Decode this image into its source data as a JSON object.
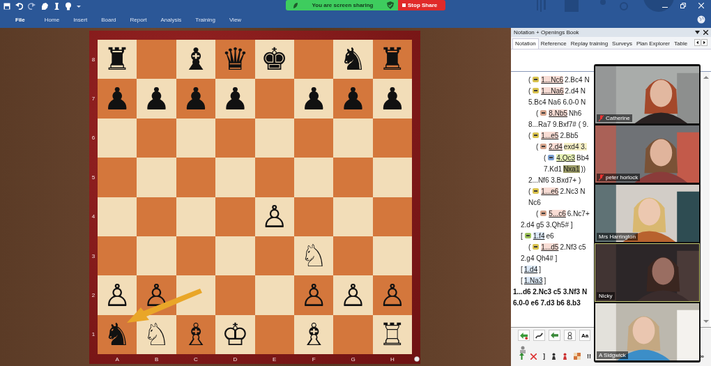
{
  "screen_share": {
    "status": "You are screen sharing",
    "stop_button": "Stop Share"
  },
  "ribbon_tabs": [
    {
      "label": "File",
      "selected": true
    },
    {
      "label": "Home",
      "selected": false
    },
    {
      "label": "Insert",
      "selected": false
    },
    {
      "label": "Board",
      "selected": false
    },
    {
      "label": "Report",
      "selected": false
    },
    {
      "label": "Analysis",
      "selected": false
    },
    {
      "label": "Training",
      "selected": false
    },
    {
      "label": "View",
      "selected": false
    }
  ],
  "board": {
    "ranks": [
      {
        "label": "8",
        "squares": [
          {
            "dark": false,
            "piece": "♜"
          },
          {
            "dark": true
          },
          {
            "dark": false,
            "piece": "♝"
          },
          {
            "dark": true,
            "piece": "♛"
          },
          {
            "dark": false,
            "piece": "♚"
          },
          {
            "dark": true
          },
          {
            "dark": false,
            "piece": "♞"
          },
          {
            "dark": true,
            "piece": "♜"
          }
        ]
      },
      {
        "label": "7",
        "squares": [
          {
            "dark": true,
            "piece": "♟"
          },
          {
            "dark": false,
            "piece": "♟"
          },
          {
            "dark": true,
            "piece": "♟"
          },
          {
            "dark": false,
            "piece": "♟"
          },
          {
            "dark": true
          },
          {
            "dark": false,
            "piece": "♟"
          },
          {
            "dark": true,
            "piece": "♟"
          },
          {
            "dark": false,
            "piece": "♟"
          }
        ]
      },
      {
        "label": "6",
        "squares": [
          {
            "dark": false
          },
          {
            "dark": true
          },
          {
            "dark": false
          },
          {
            "dark": true
          },
          {
            "dark": false
          },
          {
            "dark": true
          },
          {
            "dark": false
          },
          {
            "dark": true
          }
        ]
      },
      {
        "label": "5",
        "squares": [
          {
            "dark": true
          },
          {
            "dark": false
          },
          {
            "dark": true
          },
          {
            "dark": false
          },
          {
            "dark": true
          },
          {
            "dark": false
          },
          {
            "dark": true
          },
          {
            "dark": false
          }
        ]
      },
      {
        "label": "4",
        "squares": [
          {
            "dark": false
          },
          {
            "dark": true
          },
          {
            "dark": false
          },
          {
            "dark": true
          },
          {
            "dark": false,
            "piece": "♙"
          },
          {
            "dark": true
          },
          {
            "dark": false
          },
          {
            "dark": true
          }
        ]
      },
      {
        "label": "3",
        "squares": [
          {
            "dark": true
          },
          {
            "dark": false
          },
          {
            "dark": true
          },
          {
            "dark": false
          },
          {
            "dark": true
          },
          {
            "dark": false,
            "piece": "♘"
          },
          {
            "dark": true
          },
          {
            "dark": false
          }
        ]
      },
      {
        "label": "2",
        "squares": [
          {
            "dark": false,
            "piece": "♙"
          },
          {
            "dark": true,
            "piece": "♙"
          },
          {
            "dark": false
          },
          {
            "dark": true
          },
          {
            "dark": false
          },
          {
            "dark": true,
            "piece": "♙"
          },
          {
            "dark": false,
            "piece": "♙"
          },
          {
            "dark": true,
            "piece": "♙"
          }
        ]
      },
      {
        "label": "1",
        "squares": [
          {
            "dark": true,
            "piece": "♞"
          },
          {
            "dark": false,
            "piece": "♘"
          },
          {
            "dark": true,
            "piece": "♗"
          },
          {
            "dark": false,
            "piece": "♔"
          },
          {
            "dark": true
          },
          {
            "dark": false,
            "piece": "♗"
          },
          {
            "dark": true
          },
          {
            "dark": false,
            "piece": "♖"
          }
        ]
      }
    ],
    "files": [
      "A",
      "B",
      "C",
      "D",
      "E",
      "F",
      "G",
      "H"
    ]
  },
  "panel": {
    "title": "Notation + Openings Book",
    "tabs": [
      {
        "label": "Notation",
        "selected": true
      },
      {
        "label": "Reference",
        "selected": false
      },
      {
        "label": "Replay training",
        "selected": false
      },
      {
        "label": "Surveys",
        "selected": false
      },
      {
        "label": "Plan Explorer",
        "selected": false
      },
      {
        "label": "Table",
        "selected": false
      }
    ],
    "notation": [
      {
        "children": [
          {
            "children": [
              {
                "tokens": [
                  {
                    "kind": "text",
                    "text": "("
                  },
                  {
                    "kind": "badge",
                    "color": "#d9c24e"
                  },
                  {
                    "kind": "move",
                    "text": "1...Nc6",
                    "color": "#f8dcd4"
                  },
                  {
                    "kind": "text",
                    "text": "2.Bc4 N"
                  }
                ]
              },
              {
                "tokens": [
                  {
                    "kind": "text",
                    "text": "("
                  },
                  {
                    "kind": "badge",
                    "color": "#d9c24e"
                  },
                  {
                    "kind": "move",
                    "text": "1...Na6",
                    "color": "#f8dcd4"
                  },
                  {
                    "kind": "text",
                    "text": "2.d4 N"
                  }
                ]
              },
              {
                "tokens": [
                  {
                    "kind": "text",
                    "text": "5.Bc4 Na6 6.0-0 N"
                  }
                ]
              },
              {
                "children": [
                  {
                    "tokens": [
                      {
                        "kind": "text",
                        "text": "("
                      },
                      {
                        "kind": "badge",
                        "color": "#d6a48c"
                      },
                      {
                        "kind": "move",
                        "text": "8.Nb5",
                        "color": "#f8dcd4"
                      },
                      {
                        "kind": "text",
                        "text": "Nh6"
                      }
                    ]
                  }
                ]
              },
              {
                "tokens": [
                  {
                    "kind": "text",
                    "text": "8...Ra7 9.Bxf7# ( 9."
                  }
                ]
              },
              {
                "tokens": [
                  {
                    "kind": "text",
                    "text": "("
                  },
                  {
                    "kind": "badge",
                    "color": "#d9c24e"
                  },
                  {
                    "kind": "move",
                    "text": "1...e5",
                    "color": "#f8dcd4"
                  },
                  {
                    "kind": "text",
                    "text": "2.Bb5"
                  }
                ]
              },
              {
                "children": [
                  {
                    "tokens": [
                      {
                        "kind": "text",
                        "text": "("
                      },
                      {
                        "kind": "badge",
                        "color": "#d6a48c"
                      },
                      {
                        "kind": "move",
                        "text": "2.d4",
                        "color": "#f8dcd4"
                      },
                      {
                        "kind": "shaded",
                        "text": "exd4 3.",
                        "color": "#f7f1c6"
                      }
                    ]
                  },
                  {
                    "children": [
                      {
                        "tokens": [
                          {
                            "kind": "text",
                            "text": "("
                          },
                          {
                            "kind": "badge",
                            "color": "#7a9fd0"
                          },
                          {
                            "kind": "move",
                            "text": "4.Qc3",
                            "color": "#e4efb4"
                          },
                          {
                            "kind": "text",
                            "text": "Bb4"
                          }
                        ]
                      },
                      {
                        "tokens": [
                          {
                            "kind": "text",
                            "text": "7.Kd1"
                          },
                          {
                            "kind": "current",
                            "text": "Nxa1",
                            "color": "#9a9a66"
                          },
                          {
                            "kind": "text",
                            "text": "))"
                          }
                        ]
                      }
                    ]
                  }
                ]
              },
              {
                "tokens": [
                  {
                    "kind": "text",
                    "text": "2...Nf6 3.Bxd7+ )"
                  }
                ]
              },
              {
                "tokens": [
                  {
                    "kind": "text",
                    "text": "("
                  },
                  {
                    "kind": "badge",
                    "color": "#d9c24e"
                  },
                  {
                    "kind": "move",
                    "text": "1...e6",
                    "color": "#f8dcd4"
                  },
                  {
                    "kind": "text",
                    "text": "2.Nc3 N"
                  }
                ]
              },
              {
                "tokens": [
                  {
                    "kind": "text",
                    "text": "Nc6"
                  }
                ]
              },
              {
                "children": [
                  {
                    "tokens": [
                      {
                        "kind": "text",
                        "text": "("
                      },
                      {
                        "kind": "badge",
                        "color": "#d6a48c"
                      },
                      {
                        "kind": "move",
                        "text": "5...c6",
                        "color": "#f8dcd4"
                      },
                      {
                        "kind": "text",
                        "text": "6.Nc7+"
                      }
                    ]
                  }
                ]
              }
            ]
          },
          {
            "tokens": [
              {
                "kind": "text",
                "text": "2.d4 g5 3.Qh5# ]"
              }
            ]
          },
          {
            "tokens": [
              {
                "kind": "text",
                "text": "["
              },
              {
                "kind": "badge",
                "color": "#9cc25a"
              },
              {
                "kind": "move",
                "text": "1.f4",
                "color": "#dbe8f6"
              },
              {
                "kind": "text",
                "text": "e6"
              }
            ]
          },
          {
            "children": [
              {
                "tokens": [
                  {
                    "kind": "text",
                    "text": "("
                  },
                  {
                    "kind": "badge",
                    "color": "#d9c24e"
                  },
                  {
                    "kind": "move",
                    "text": "1...d5",
                    "color": "#f8dcd4"
                  },
                  {
                    "kind": "text",
                    "text": "2.Nf3 c5"
                  }
                ]
              }
            ]
          },
          {
            "tokens": [
              {
                "kind": "text",
                "text": "2.g4 Qh4# ]"
              }
            ]
          },
          {
            "tokens": [
              {
                "kind": "text",
                "text": "["
              },
              {
                "kind": "move",
                "text": "1.d4",
                "color": "#dbe8f6"
              },
              {
                "kind": "text",
                "text": "]"
              }
            ]
          },
          {
            "tokens": [
              {
                "kind": "text",
                "text": "["
              },
              {
                "kind": "move",
                "text": "1.Na3",
                "color": "#dbe8f6"
              },
              {
                "kind": "text",
                "text": "]"
              }
            ]
          }
        ]
      },
      {
        "tokens": [
          {
            "kind": "text",
            "text": "1...d6 2.Nc3 c5 3.Nf3 N"
          }
        ]
      },
      {
        "tokens": [
          {
            "kind": "text",
            "text": "6.0-0 e6 7.d3 b6 8.b3"
          }
        ]
      }
    ],
    "toolbar_text_button": "Aa",
    "annotation_symbols": [
      "]",
      "!!",
      "∞"
    ]
  },
  "video_tiles": [
    {
      "name": "Catherine",
      "muted": true,
      "speaking": false
    },
    {
      "name": "peter horlock",
      "muted": true,
      "speaking": false
    },
    {
      "name": "Mrs Harrington",
      "muted": false,
      "speaking": false
    },
    {
      "name": "Nicky",
      "muted": false,
      "speaking": true
    },
    {
      "name": "A Sidgwick",
      "muted": false,
      "speaking": false
    }
  ]
}
